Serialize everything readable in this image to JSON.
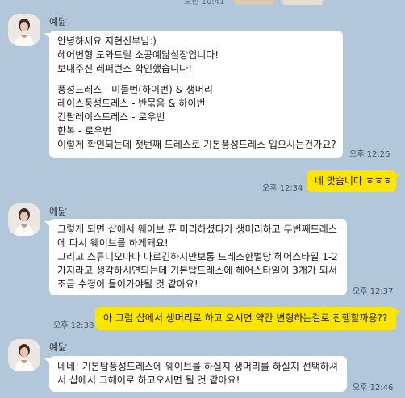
{
  "top": {
    "time_label": "오전 10:41"
  },
  "messages": [
    {
      "sender": "예닮",
      "lines": [
        "안녕하세요 지현신부님:)",
        "헤어변형 도와드릴 소공예닮실장입니다!",
        "보내주신 레퍼런스 확인했습니다!",
        "",
        "풍성드레스 - 미들번(하이번) & 생머리",
        "레이스풍성드레스 - 반묶음 & 하이번",
        "긴팔레이스드레스 - 로우번",
        "한복 - 로우번",
        "이렇게 확인되는데 첫번째 드레스로 기본풍성드레스 입으시는건가요?"
      ],
      "time": "오후 12:26"
    },
    {
      "text": "네 맞습니다 ㅎㅎㅎ",
      "time": "오후 12:34"
    },
    {
      "sender": "예닮",
      "lines": [
        "그렇게 되면 샵에서 웨이브 푼 머리하셨다가 생머리하고 두번째드레스",
        "에 다시 웨이브를 하게돼요!",
        "그리고 스튜디오마다 다르긴하지만보통 드레스한벌당 헤어스타일 1-2",
        "가지라고 생각하시면되는데 기본탑드레스에 헤어스타일이 3개가 되서",
        "조금 수정이 들어가야될 것 같아요!"
      ],
      "time": "오후 12:37"
    },
    {
      "text": "아 그럼 샵에서 생머리로 하고 오시면 약간 변형하는걸로 진행할까용??",
      "time": "오후 12:38"
    },
    {
      "sender": "예닮",
      "lines": [
        "네네! 기본탑풍성드레스에 웨이브를 하실지 생머리를 하실지 선택하셔",
        "서 샵에서 그헤어로 하고오시면 될 것 같아요!"
      ],
      "time": "오후 12:46"
    }
  ],
  "colors": {
    "background": "#b2c7d9",
    "my_bubble": "#fee500",
    "their_bubble": "#ffffff"
  },
  "icons": {
    "avatar": "profile-photo-icon"
  }
}
